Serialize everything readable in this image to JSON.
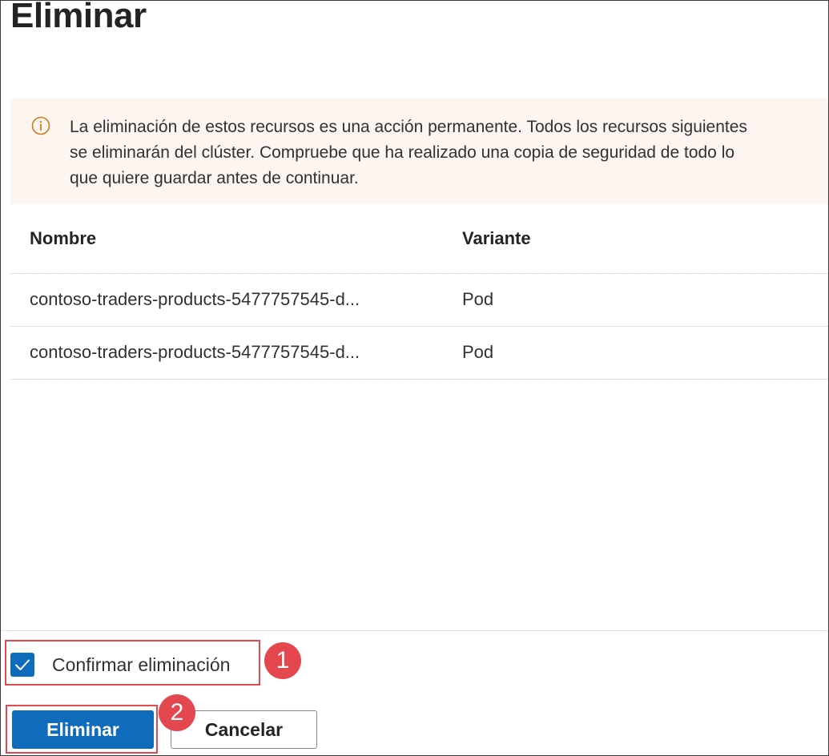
{
  "dialog": {
    "title": "Eliminar"
  },
  "warning": {
    "icon": "info-icon",
    "color": "#d0791f",
    "lines": [
      "La eliminación de estos recursos es una acción permanente. Todos los recursos siguientes",
      "se eliminarán del clúster. Compruebe que ha realizado una copia de seguridad de todo lo",
      "que quiere guardar antes de continuar."
    ]
  },
  "table": {
    "columns": [
      "Nombre",
      "Variante"
    ],
    "rows": [
      {
        "name": "contoso-traders-products-5477757545-d...",
        "kind": "Pod"
      },
      {
        "name": "contoso-traders-products-5477757545-d...",
        "kind": "Pod"
      }
    ]
  },
  "confirm": {
    "label": "Confirmar eliminación",
    "checked": true
  },
  "buttons": {
    "delete": "Eliminar",
    "cancel": "Cancelar"
  },
  "annotations": {
    "step1": "1",
    "step2": "2",
    "color": "#e4474d"
  },
  "colors": {
    "primary": "#0f6cbd",
    "warning_bg": "#fdf6f0"
  }
}
